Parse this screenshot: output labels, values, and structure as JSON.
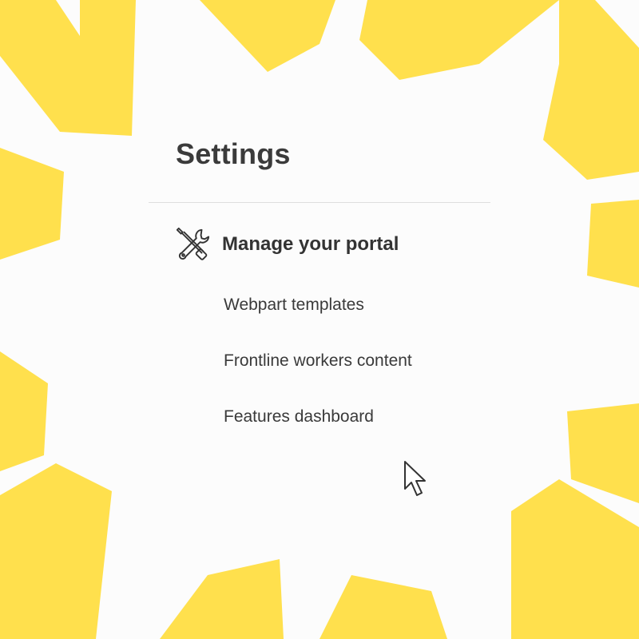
{
  "colors": {
    "background": "#fcfcfc",
    "accent_shapes": "#ffe04d",
    "title_text": "#3b3b3b",
    "body_text": "#3a3a3a",
    "divider": "#dedede"
  },
  "settings": {
    "title": "Settings",
    "section": {
      "icon": "tools-icon",
      "label": "Manage your portal"
    },
    "items": [
      {
        "label": "Webpart templates"
      },
      {
        "label": "Frontline workers content"
      },
      {
        "label": "Features dashboard"
      }
    ]
  },
  "pointer": {
    "icon": "mouse-pointer-icon"
  }
}
